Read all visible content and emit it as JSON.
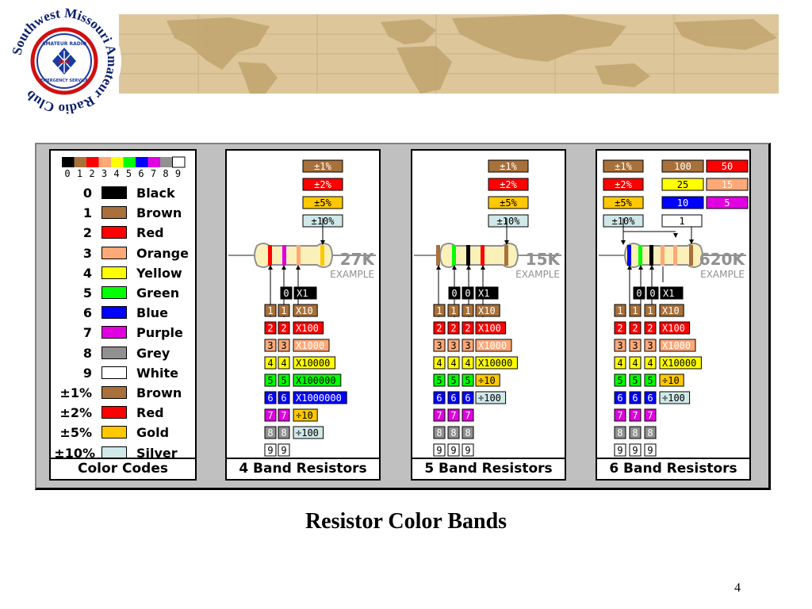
{
  "logo": {
    "ring_text": "Southwest Missouri Amateur Radio Club",
    "inner_top": "AMATEUR RADIO",
    "inner_bottom": "EMERGENCY SERVICE",
    "emblem": "ARES"
  },
  "colors": [
    {
      "digit": "0",
      "name": "Black",
      "hex": "#000000"
    },
    {
      "digit": "1",
      "name": "Brown",
      "hex": "#a8703a"
    },
    {
      "digit": "2",
      "name": "Red",
      "hex": "#ff0000"
    },
    {
      "digit": "3",
      "name": "Orange",
      "hex": "#ffa878"
    },
    {
      "digit": "4",
      "name": "Yellow",
      "hex": "#ffff00"
    },
    {
      "digit": "5",
      "name": "Green",
      "hex": "#00ff00"
    },
    {
      "digit": "6",
      "name": "Blue",
      "hex": "#0000ff"
    },
    {
      "digit": "7",
      "name": "Purple",
      "hex": "#e000e0"
    },
    {
      "digit": "8",
      "name": "Grey",
      "hex": "#909090"
    },
    {
      "digit": "9",
      "name": "White",
      "hex": "#ffffff"
    }
  ],
  "tolerances": [
    {
      "label": "±1%",
      "name": "Brown",
      "hex": "#a8703a"
    },
    {
      "label": "±2%",
      "name": "Red",
      "hex": "#ff0000"
    },
    {
      "label": "±5%",
      "name": "Gold",
      "hex": "#ffc800"
    },
    {
      "label": "±10%",
      "name": "Silver",
      "hex": "#d0e8e8"
    }
  ],
  "digits_strip": "0123456789",
  "footers": {
    "codes": "Color Codes",
    "four": "4 Band Resistors",
    "five": "5 Band Resistors",
    "six": "6 Band Resistors"
  },
  "four_band": {
    "value": "27K",
    "example": "EXAMPLE",
    "row0_digit": "0",
    "row0_mult": "X1",
    "multipliers": [
      "X10",
      "X100",
      "X1000",
      "X10000",
      "X100000",
      "X1000000",
      "÷10",
      "÷100"
    ]
  },
  "five_band": {
    "value": "15K",
    "example": "EXAMPLE",
    "row0_mult": "X1",
    "multipliers": [
      "X10",
      "X100",
      "X1000",
      "X10000",
      "÷10",
      "÷100"
    ]
  },
  "six_band": {
    "value": "620K",
    "example": "EXAMPLE",
    "row0_mult": "X1",
    "multipliers": [
      "X10",
      "X100",
      "X1000",
      "X10000",
      "÷10",
      "÷100"
    ],
    "tempco": [
      {
        "label": "100",
        "hex": "#a8703a"
      },
      {
        "label": "50",
        "hex": "#ff0000"
      },
      {
        "label": "25",
        "hex": "#ffff00"
      },
      {
        "label": "15",
        "hex": "#ffa878"
      },
      {
        "label": "10",
        "hex": "#0000ff"
      },
      {
        "label": "5",
        "hex": "#e000e0"
      },
      {
        "label": "1",
        "hex": "#ffffff"
      }
    ]
  },
  "caption": "Resistor Color Bands",
  "page_number": "4"
}
